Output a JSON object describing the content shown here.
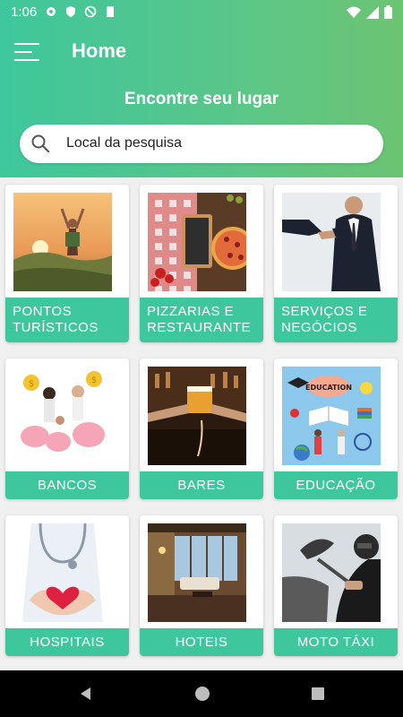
{
  "status": {
    "time": "1:06"
  },
  "header": {
    "title": "Home",
    "subtitle": "Encontre seu lugar"
  },
  "search": {
    "placeholder": "Local da pesquisa"
  },
  "categories": [
    {
      "label": "PONTOS TURÍSTICOS",
      "line1": "PONTOS",
      "line2": "TURÍSTICOS"
    },
    {
      "label": "PIZZARIAS E RESTAURANTE",
      "line1": "PIZZARIAS E",
      "line2": "RESTAURANTE"
    },
    {
      "label": "SERVIÇOS E NEGÓCIOS",
      "line1": "SERVIÇOS E",
      "line2": "NEGÓCIOS"
    },
    {
      "label": "BANCOS"
    },
    {
      "label": "BARES"
    },
    {
      "label": "EDUCAÇÃO",
      "image_text": "EDUCATION"
    },
    {
      "label": "HOSPITAIS"
    },
    {
      "label": "HOTEIS"
    },
    {
      "label": "MOTO TÁXI"
    }
  ],
  "colors": {
    "accent": "#3ec79c",
    "header_start": "#3ec79c",
    "header_end": "#6cc472"
  }
}
